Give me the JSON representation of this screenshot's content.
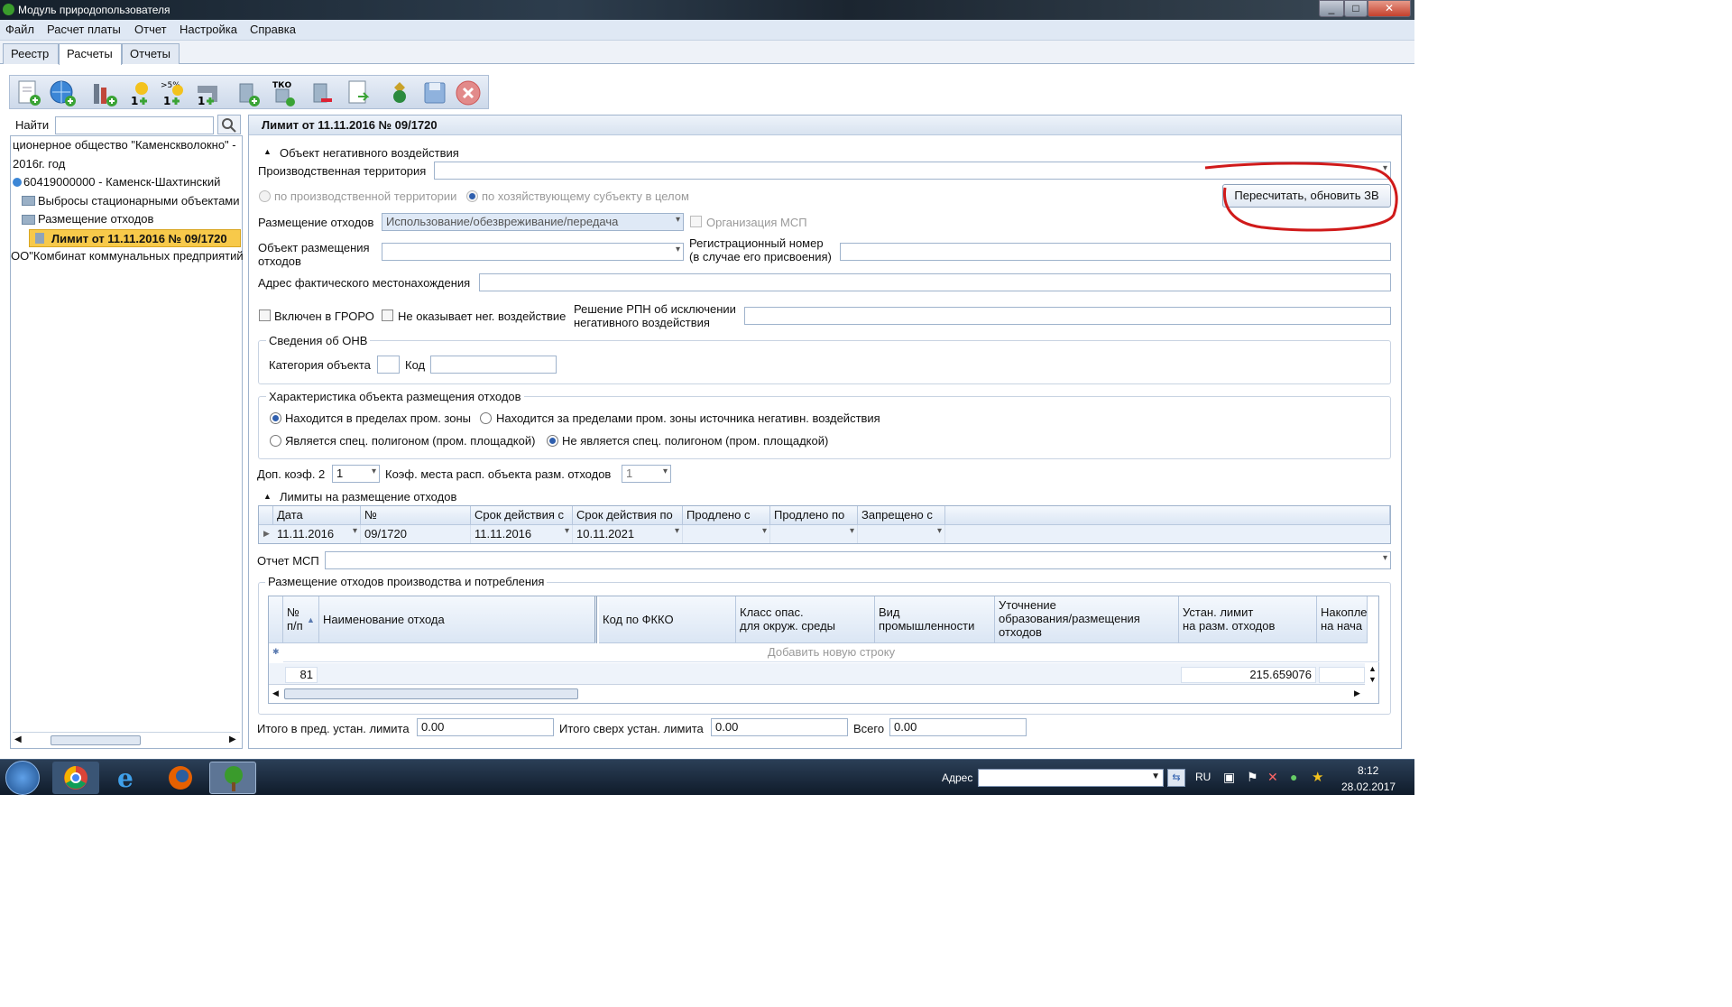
{
  "window": {
    "title": "Модуль природопользователя",
    "controls": [
      "_",
      "□",
      "✕"
    ]
  },
  "menu": [
    "Файл",
    "Расчет платы",
    "Отчет",
    "Настройка",
    "Справка"
  ],
  "tabs": [
    {
      "label": "Реестр"
    },
    {
      "label": "Расчеты",
      "active": true
    },
    {
      "label": "Отчеты"
    }
  ],
  "toolbar": {
    "icons": [
      "new-document-icon",
      "globe-add-icon",
      "chimney-add-icon",
      "sun-add-icon",
      "sun-percent-add-icon",
      "pipe-add-icon",
      "bin-add-icon",
      "tko-bin-icon",
      "bin-remove-icon",
      "export-document-icon",
      "emblem-icon",
      "save-icon",
      "cancel-icon"
    ],
    "badge_percent": ">5%",
    "badge_tko": "ТКО"
  },
  "left": {
    "search_label": "Найти",
    "search_value": "",
    "tree": [
      "ционерное общество \"Каменскволокно\" -",
      "2016г. год",
      "60419000000 - Каменск-Шахтинский",
      "Выбросы стационарными объектами",
      "Размещение отходов",
      "Лимит от 11.11.2016 № 09/1720",
      "ОО\"Комбинат коммунальных предприятий"
    ]
  },
  "form": {
    "header": "Лимит от 11.11.2016 № 09/1720",
    "section_object": "Объект негативного воздействия",
    "prod_territory_label": "Производственная территория",
    "prod_territory_value": "",
    "radio_by_territory": "по производственной территории",
    "radio_by_subject": "по хозяйствующему субъекту в целом",
    "recalc_button": "Пересчитать, обновить ЗВ",
    "waste_placement_label": "Размещение отходов",
    "waste_placement_value": "Использование/обезвреживание/передача",
    "msp_org_label": "Организация МСП",
    "placement_object_label_1": "Объект размещения",
    "placement_object_label_2": "отходов",
    "placement_object_value": "",
    "reg_number_label_1": "Регистрационный номер",
    "reg_number_label_2": "(в случае его присвоения)",
    "reg_number_value": "",
    "address_label": "Адрес фактического местонахождения",
    "address_value": "",
    "groro_label": "Включен в ГРОРО",
    "no_impact_label": "Не оказывает нег. воздействие",
    "rpn_label_1": "Решение РПН об исключении",
    "rpn_label_2": "негативного воздействия",
    "rpn_value": "",
    "onv_group": "Сведения об ОНВ",
    "category_label": "Категория объекта",
    "category_value": "",
    "code_label": "Код",
    "code_value": "",
    "char_group": "Характеристика объекта размещения отходов",
    "r_in_zone": "Находится в пределах пром. зоны",
    "r_out_zone": "Находится за пределами пром. зоны источника негативн. воздействия",
    "r_is_polygon": "Является спец. полигоном (пром. площадкой)",
    "r_not_polygon": "Не является спец. полигоном (пром. площадкой)",
    "coef2_label": "Доп. коэф. 2",
    "coef2_value": "1",
    "coef_place_label": "Коэф. места расп. объекта разм. отходов",
    "coef_place_value": "1",
    "limits_section": "Лимиты на размещение отходов",
    "limits_headers": [
      "Дата",
      "№",
      "Срок действия с",
      "Срок действия по",
      "Продлено с",
      "Продлено по",
      "Запрещено с"
    ],
    "limits_row": [
      "11.11.2016",
      "09/1720",
      "11.11.2016",
      "10.11.2021",
      "",
      "",
      ""
    ],
    "msp_report_label": "Отчет МСП",
    "msp_report_value": "",
    "placement_group": "Размещение отходов производства и потребления",
    "waste_headers": {
      "num_1": "№",
      "num_2": "п/п",
      "name": "Наименование отхода",
      "fkko": "Код по ФККО",
      "class_1": "Класс опас.",
      "class_2": "для окруж. среды",
      "industry_1": "Вид",
      "industry_2": "промышленности",
      "clar_1": "Уточнение",
      "clar_2": "образования/размещения",
      "clar_3": "отходов",
      "limit_1": "Устан. лимит",
      "limit_2": "на разм. отходов",
      "accum_1": "Накопле",
      "accum_2": "на нача"
    },
    "add_row": "Добавить новую строку",
    "total_count": "81",
    "total_limit": "215.659076",
    "totals": {
      "within_label": "Итого в пред. устан. лимита",
      "within_value": "0.00",
      "over_label": "Итого сверх устан. лимита",
      "over_value": "0.00",
      "all_label": "Всего",
      "all_value": "0.00"
    }
  },
  "taskbar": {
    "address_label": "Адрес",
    "lang": "RU",
    "time": "8:12",
    "date": "28.02.2017"
  },
  "colors": {
    "accent": "#2f5fae",
    "highlight_selected": "#f7c94a",
    "annotation": "#d01a1a"
  }
}
